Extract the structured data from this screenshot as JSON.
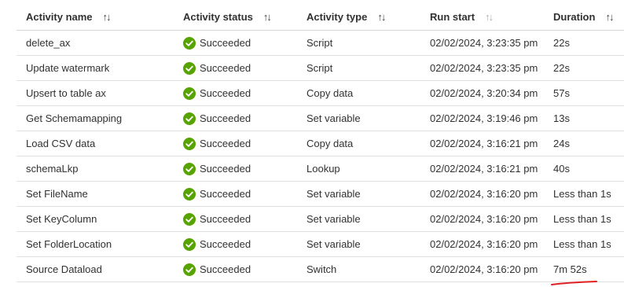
{
  "columns": [
    {
      "label": "Activity name"
    },
    {
      "label": "Activity status"
    },
    {
      "label": "Activity type"
    },
    {
      "label": "Run start"
    },
    {
      "label": "Duration"
    }
  ],
  "success_color": "#57a300",
  "rows": [
    {
      "name": "delete_ax",
      "status": "Succeeded",
      "type": "Script",
      "run_start": "02/02/2024, 3:23:35 pm",
      "duration": "22s"
    },
    {
      "name": "Update watermark",
      "status": "Succeeded",
      "type": "Script",
      "run_start": "02/02/2024, 3:23:35 pm",
      "duration": "22s"
    },
    {
      "name": "Upsert to table ax",
      "status": "Succeeded",
      "type": "Copy data",
      "run_start": "02/02/2024, 3:20:34 pm",
      "duration": "57s"
    },
    {
      "name": "Get Schemamapping",
      "status": "Succeeded",
      "type": "Set variable",
      "run_start": "02/02/2024, 3:19:46 pm",
      "duration": "13s"
    },
    {
      "name": "Load CSV data",
      "status": "Succeeded",
      "type": "Copy data",
      "run_start": "02/02/2024, 3:16:21 pm",
      "duration": "24s"
    },
    {
      "name": "schemaLkp",
      "status": "Succeeded",
      "type": "Lookup",
      "run_start": "02/02/2024, 3:16:21 pm",
      "duration": "40s"
    },
    {
      "name": "Set FileName",
      "status": "Succeeded",
      "type": "Set variable",
      "run_start": "02/02/2024, 3:16:20 pm",
      "duration": "Less than 1s"
    },
    {
      "name": "Set KeyColumn",
      "status": "Succeeded",
      "type": "Set variable",
      "run_start": "02/02/2024, 3:16:20 pm",
      "duration": "Less than 1s"
    },
    {
      "name": "Set FolderLocation",
      "status": "Succeeded",
      "type": "Set variable",
      "run_start": "02/02/2024, 3:16:20 pm",
      "duration": "Less than 1s"
    },
    {
      "name": "Source Dataload",
      "status": "Succeeded",
      "type": "Switch",
      "run_start": "02/02/2024, 3:16:20 pm",
      "duration": "7m 52s"
    }
  ]
}
